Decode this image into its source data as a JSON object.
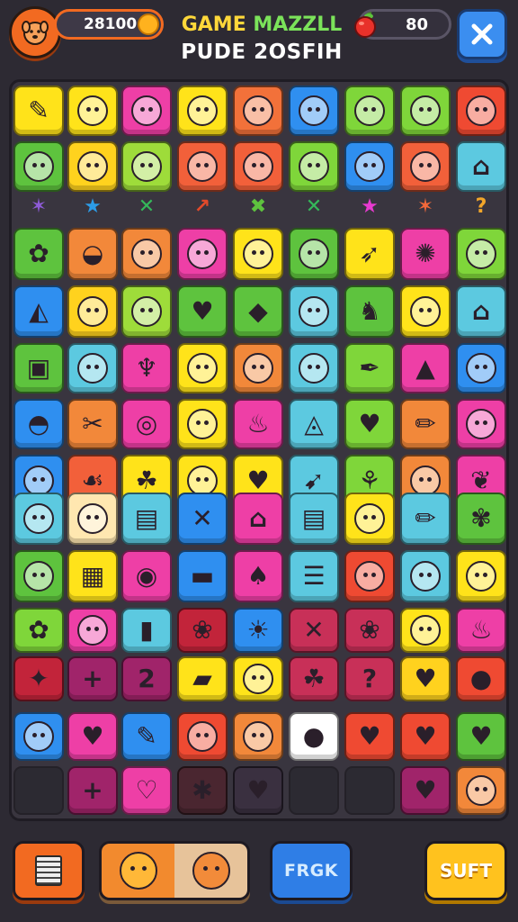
{
  "header": {
    "score": "28100",
    "title_line1_a": "GAME ",
    "title_line1_b": "MAZZLL",
    "title_line2": "PUDE 2OSFIH",
    "moves": "80"
  },
  "separators": [
    {
      "glyph": "✶",
      "color": "#8e5bd8"
    },
    {
      "glyph": "★",
      "color": "#2c9ce8"
    },
    {
      "glyph": "✕",
      "color": "#35b85a"
    },
    {
      "glyph": "↗",
      "color": "#e24a2a"
    },
    {
      "glyph": "✖",
      "color": "#5ec33e"
    },
    {
      "glyph": "✕",
      "color": "#35b85a"
    },
    {
      "glyph": "★",
      "color": "#e83ad0"
    },
    {
      "glyph": "✶",
      "color": "#f2683a"
    },
    {
      "glyph": "?",
      "color": "#f2a62a"
    }
  ],
  "board": {
    "rows": [
      [
        {
          "color": "#ffe31a",
          "icon": "ice-cream-icon",
          "glyph": "✎"
        },
        {
          "color": "#ffe31a",
          "icon": "blob-face-icon",
          "glyph": "face"
        },
        {
          "color": "#ee3fa6",
          "icon": "cat-face-icon",
          "glyph": "face"
        },
        {
          "color": "#ffe31a",
          "icon": "white-cat-icon",
          "glyph": "face"
        },
        {
          "color": "#f2713a",
          "icon": "cat-face-icon",
          "glyph": "face"
        },
        {
          "color": "#2f8ff0",
          "icon": "smile-face-icon",
          "glyph": "face"
        },
        {
          "color": "#7fd63a",
          "icon": "red-cat-icon",
          "glyph": "face"
        },
        {
          "color": "#7fd63a",
          "icon": "cat-face-icon",
          "glyph": "face"
        },
        {
          "color": "#ef4a32",
          "icon": "white-cat-icon",
          "glyph": "face"
        }
      ],
      [
        {
          "color": "#5ec33e",
          "icon": "fox-icon",
          "glyph": "face"
        },
        {
          "color": "#ffd21e",
          "icon": "cat-hat-icon",
          "glyph": "face"
        },
        {
          "color": "#9edc3a",
          "icon": "red-ball-icon",
          "glyph": "face"
        },
        {
          "color": "#f2603a",
          "icon": "monster-icon",
          "glyph": "face"
        },
        {
          "color": "#f2603a",
          "icon": "bunny-icon",
          "glyph": "face"
        },
        {
          "color": "#7fd63a",
          "icon": "yellow-face-icon",
          "glyph": "face"
        },
        {
          "color": "#2f8ff0",
          "icon": "ghost-face-icon",
          "glyph": "face"
        },
        {
          "color": "#f2603a",
          "icon": "snowman-icon",
          "glyph": "face"
        },
        {
          "color": "#5cc9e0",
          "icon": "basket-icon",
          "glyph": "⌂"
        }
      ],
      [
        {
          "color": "#5ec33e",
          "icon": "leaf-icon",
          "glyph": "✿"
        },
        {
          "color": "#f2883a",
          "icon": "shell-icon",
          "glyph": "◒"
        },
        {
          "color": "#f2883a",
          "icon": "white-cat-icon",
          "glyph": "face"
        },
        {
          "color": "#ee3fa6",
          "icon": "pink-face-icon",
          "glyph": "face"
        },
        {
          "color": "#ffe31a",
          "icon": "monkey-icon",
          "glyph": "face"
        },
        {
          "color": "#5ec33e",
          "icon": "green-face-icon",
          "glyph": "face"
        },
        {
          "color": "#ffe31a",
          "icon": "bird-icon",
          "glyph": "➶"
        },
        {
          "color": "#ee3fa6",
          "icon": "flower-icon",
          "glyph": "✺"
        },
        {
          "color": "#7fd63a",
          "icon": "cat-face-icon",
          "glyph": "face"
        }
      ],
      [
        {
          "color": "#2f8ff0",
          "icon": "cheese-icon",
          "glyph": "◭"
        },
        {
          "color": "#ffd21e",
          "icon": "red-cat-icon",
          "glyph": "face"
        },
        {
          "color": "#9edc3a",
          "icon": "cat-face-icon",
          "glyph": "face"
        },
        {
          "color": "#5ec33e",
          "icon": "heart-icon",
          "glyph": "♥"
        },
        {
          "color": "#5ec33e",
          "icon": "carrot-icon",
          "glyph": "◆"
        },
        {
          "color": "#5cc9e0",
          "icon": "pink-cat-icon",
          "glyph": "face"
        },
        {
          "color": "#5ec33e",
          "icon": "unicorn-icon",
          "glyph": "♞"
        },
        {
          "color": "#ffe31a",
          "icon": "green-cat-icon",
          "glyph": "face"
        },
        {
          "color": "#5cc9e0",
          "icon": "mushroom-icon",
          "glyph": "⌂"
        }
      ],
      [
        {
          "color": "#5ec33e",
          "icon": "gift-box-icon",
          "glyph": "▣"
        },
        {
          "color": "#5cc9e0",
          "icon": "smile-face-icon",
          "glyph": "face"
        },
        {
          "color": "#ee3fa6",
          "icon": "swirl-icon",
          "glyph": "♆"
        },
        {
          "color": "#ffe31a",
          "icon": "white-cat-icon",
          "glyph": "face"
        },
        {
          "color": "#f2883a",
          "icon": "lion-icon",
          "glyph": "face"
        },
        {
          "color": "#5cc9e0",
          "icon": "mushroom-cap-icon",
          "glyph": "face"
        },
        {
          "color": "#7fd63a",
          "icon": "feather-icon",
          "glyph": "✒"
        },
        {
          "color": "#ee3fa6",
          "icon": "cheese-wedge-icon",
          "glyph": "▲"
        },
        {
          "color": "#2f8ff0",
          "icon": "red-cat-icon",
          "glyph": "face"
        }
      ],
      [
        {
          "color": "#2f8ff0",
          "icon": "hat-icon",
          "glyph": "◓"
        },
        {
          "color": "#f2883a",
          "icon": "scissors-icon",
          "glyph": "✂"
        },
        {
          "color": "#ee3fa6",
          "icon": "donut-icon",
          "glyph": "◎"
        },
        {
          "color": "#ffe31a",
          "icon": "robot-icon",
          "glyph": "face"
        },
        {
          "color": "#ee3fa6",
          "icon": "bell-icon",
          "glyph": "♨"
        },
        {
          "color": "#5cc9e0",
          "icon": "sled-icon",
          "glyph": "◬"
        },
        {
          "color": "#7fd63a",
          "icon": "heart-icon",
          "glyph": "♥"
        },
        {
          "color": "#f2883a",
          "icon": "pencil-icon",
          "glyph": "✏"
        },
        {
          "color": "#ee3fa6",
          "icon": "bunny-icon",
          "glyph": "face"
        }
      ],
      [
        {
          "color": "#2f8ff0",
          "icon": "egg-face-icon",
          "glyph": "face"
        },
        {
          "color": "#f2603a",
          "icon": "bird-icon",
          "glyph": "☙"
        },
        {
          "color": "#ffe31a",
          "icon": "cat-icon",
          "glyph": "☘"
        },
        {
          "color": "#ffe31a",
          "icon": "fish-icon",
          "glyph": "face"
        },
        {
          "color": "#ffe31a",
          "icon": "apple-icon",
          "glyph": "♥"
        },
        {
          "color": "#5cc9e0",
          "icon": "rocket-icon",
          "glyph": "➹"
        },
        {
          "color": "#7fd63a",
          "icon": "bow-icon",
          "glyph": "⚘"
        },
        {
          "color": "#f2883a",
          "icon": "lion-icon",
          "glyph": "face"
        },
        {
          "color": "#ee3fa6",
          "icon": "sprout-icon",
          "glyph": "❦"
        }
      ],
      [
        {
          "color": "#5cc9e0",
          "icon": "cat-face-icon",
          "glyph": "face"
        },
        {
          "color": "#ffe7b0",
          "icon": "cat-face-icon",
          "glyph": "face"
        },
        {
          "color": "#5cc9e0",
          "icon": "camera-icon",
          "glyph": "▤"
        },
        {
          "color": "#2f8ff0",
          "icon": "tools-icon",
          "glyph": "✕"
        },
        {
          "color": "#ee3fa6",
          "icon": "house-icon",
          "glyph": "⌂"
        },
        {
          "color": "#5cc9e0",
          "icon": "camera-icon",
          "glyph": "▤"
        },
        {
          "color": "#ffe31a",
          "icon": "red-face-icon",
          "glyph": "face"
        },
        {
          "color": "#5cc9e0",
          "icon": "pencil-icon",
          "glyph": "✏"
        },
        {
          "color": "#5ec33e",
          "icon": "flower-icon",
          "glyph": "✾"
        }
      ],
      [
        {
          "color": "#5ec33e",
          "icon": "cat-face-icon",
          "glyph": "face"
        },
        {
          "color": "#ffe31a",
          "icon": "radio-icon",
          "glyph": "▦"
        },
        {
          "color": "#ee3fa6",
          "icon": "record-icon",
          "glyph": "◉"
        },
        {
          "color": "#2f8ff0",
          "icon": "cake-icon",
          "glyph": "▬"
        },
        {
          "color": "#ee3fa6",
          "icon": "leaf-icon",
          "glyph": "♠"
        },
        {
          "color": "#5cc9e0",
          "icon": "burger-icon",
          "glyph": "☰"
        },
        {
          "color": "#ef4a32",
          "icon": "gray-cat-icon",
          "glyph": "face"
        },
        {
          "color": "#5cc9e0",
          "icon": "orange-face-icon",
          "glyph": "face"
        },
        {
          "color": "#ffe31a",
          "icon": "orange-face-icon",
          "glyph": "face"
        }
      ],
      [
        {
          "color": "#7fd63a",
          "icon": "flower-icon",
          "glyph": "✿"
        },
        {
          "color": "#ee3fa6",
          "icon": "orange-ball-icon",
          "glyph": "face"
        },
        {
          "color": "#5cc9e0",
          "icon": "bottle-icon",
          "glyph": "▮"
        },
        {
          "color": "#c2243a",
          "icon": "rose-icon",
          "glyph": "❀"
        },
        {
          "color": "#2f8ff0",
          "icon": "sun-icon",
          "glyph": "☀"
        },
        {
          "color": "#c83058",
          "icon": "swords-icon",
          "glyph": "✕"
        },
        {
          "color": "#c83058",
          "icon": "rose-icon",
          "glyph": "❀"
        },
        {
          "color": "#ffe31a",
          "icon": "glasses-face-icon",
          "glyph": "face"
        },
        {
          "color": "#ee3fa6",
          "icon": "fire-icon",
          "glyph": "♨"
        }
      ],
      [
        {
          "color": "#c2243a",
          "icon": "star-icon",
          "glyph": "✦"
        },
        {
          "color": "#a0246a",
          "icon": "plus-icon",
          "glyph": "+"
        },
        {
          "color": "#a0246a",
          "icon": "number-two-icon",
          "glyph": "2"
        },
        {
          "color": "#ffe31a",
          "icon": "book-icon",
          "glyph": "▰"
        },
        {
          "color": "#ffe31a",
          "icon": "orange-face-icon",
          "glyph": "face"
        },
        {
          "color": "#c83058",
          "icon": "leaf-icon",
          "glyph": "☘"
        },
        {
          "color": "#c83058",
          "icon": "question-icon",
          "glyph": "?"
        },
        {
          "color": "#ffd21e",
          "icon": "heart-icon",
          "glyph": "♥"
        },
        {
          "color": "#ef4a32",
          "icon": "blob-icon",
          "glyph": "●"
        }
      ],
      [
        {
          "color": "#2f8ff0",
          "icon": "monster-icon",
          "glyph": "face"
        },
        {
          "color": "#ee3fa6",
          "icon": "heart-icon",
          "glyph": "♥"
        },
        {
          "color": "#2f8ff0",
          "icon": "carrot-icon",
          "glyph": "✎"
        },
        {
          "color": "#ef4a32",
          "icon": "cat-face-icon",
          "glyph": "face"
        },
        {
          "color": "#f2883a",
          "icon": "blue-face-icon",
          "glyph": "face"
        },
        {
          "color": "#ffffff",
          "icon": "orange-fruit-icon",
          "glyph": "●"
        },
        {
          "color": "#ef4a32",
          "icon": "heart-icon",
          "glyph": "♥"
        },
        {
          "color": "#ef4a32",
          "icon": "heart-icon",
          "glyph": "♥"
        },
        {
          "color": "#5ec33e",
          "icon": "heart-icon",
          "glyph": "♥"
        }
      ],
      [
        {
          "color": "#2c2a32",
          "icon": "empty-slot",
          "glyph": ""
        },
        {
          "color": "#a0246a",
          "icon": "plus-icon",
          "glyph": "+"
        },
        {
          "color": "#ee3fa6",
          "icon": "heart-icon",
          "glyph": "♡"
        },
        {
          "color": "#4a2630",
          "icon": "sparkle-icon",
          "glyph": "✱"
        },
        {
          "color": "#3a3040",
          "icon": "heart-icon",
          "glyph": "♥"
        },
        {
          "color": "#2c2a32",
          "icon": "empty-slot",
          "glyph": ""
        },
        {
          "color": "#2c2a32",
          "icon": "empty-slot",
          "glyph": ""
        },
        {
          "color": "#a0246a",
          "icon": "heart-icon",
          "glyph": "♥"
        },
        {
          "color": "#f2883a",
          "icon": "orange-face-icon",
          "glyph": "face"
        }
      ]
    ]
  },
  "footer": {
    "action_button": "FRGK",
    "shuffle_button": "SUFT"
  }
}
